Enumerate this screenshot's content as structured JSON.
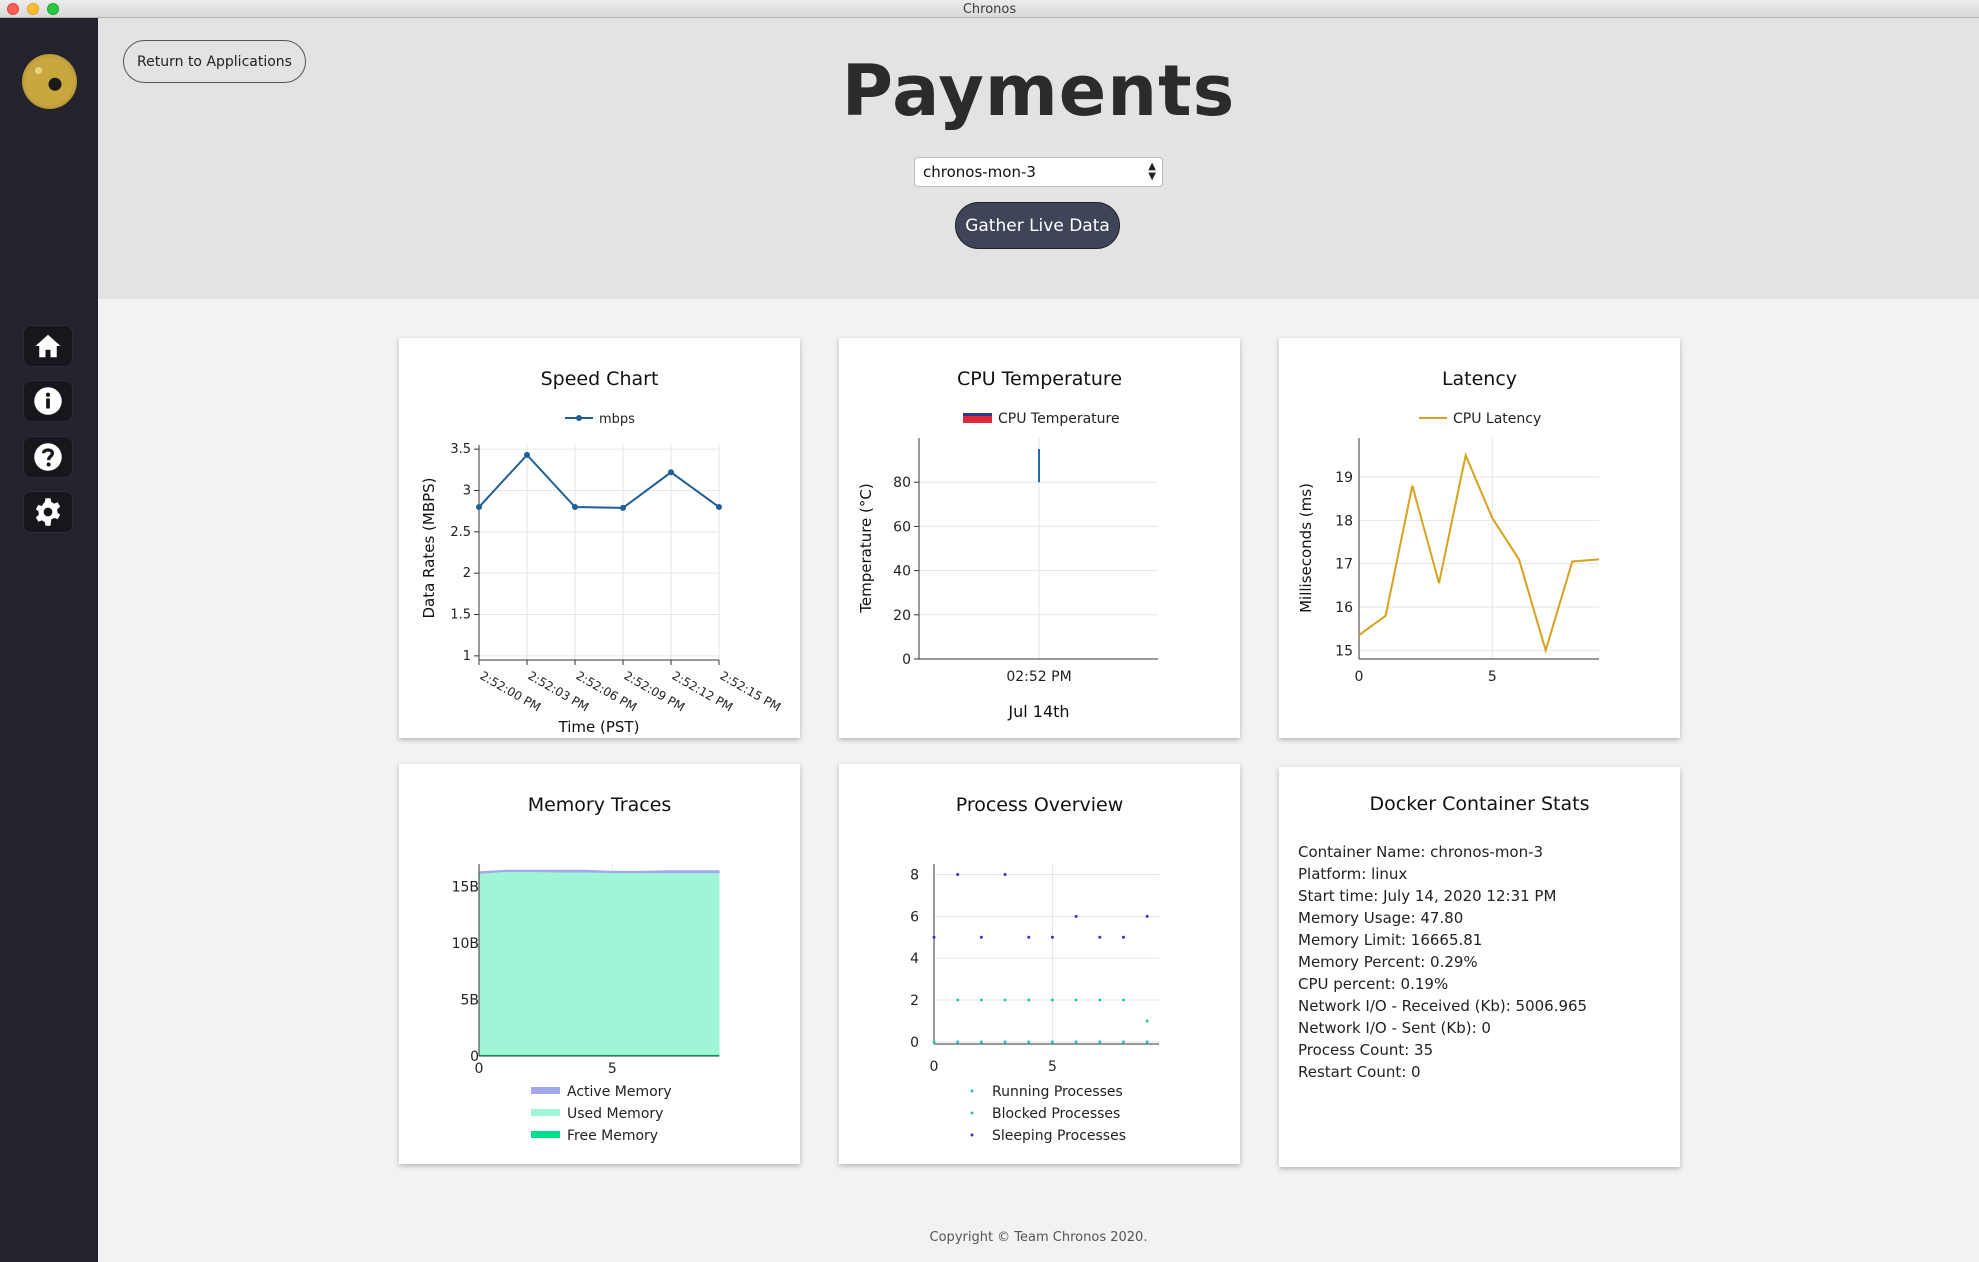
{
  "window": {
    "title": "Chronos"
  },
  "sidebar": {
    "logo": "chronos-logo",
    "items": [
      {
        "name": "home",
        "icon": "home-icon"
      },
      {
        "name": "info",
        "icon": "info-icon"
      },
      {
        "name": "help",
        "icon": "help-icon"
      },
      {
        "name": "settings",
        "icon": "gear-icon"
      }
    ]
  },
  "header": {
    "return_label": "Return to Applications",
    "title": "Payments",
    "selected_container": "chronos-mon-3",
    "gather_label": "Gather Live Data"
  },
  "cards": {
    "speed": {
      "title": "Speed Chart"
    },
    "cpu": {
      "title": "CPU Temperature"
    },
    "latency": {
      "title": "Latency"
    },
    "memory": {
      "title": "Memory Traces"
    },
    "process": {
      "title": "Process Overview"
    },
    "docker": {
      "title": "Docker Container Stats",
      "stats": [
        "Container Name: chronos-mon-3",
        "Platform: linux",
        "Start time: July 14, 2020 12:31 PM",
        "Memory Usage: 47.80",
        "Memory Limit: 16665.81",
        "Memory Percent: 0.29%",
        "CPU percent: 0.19%",
        "Network I/O - Received (Kb): 5006.965",
        "Network I/O - Sent (Kb): 0",
        "Process Count: 35",
        "Restart Count: 0"
      ]
    }
  },
  "footer": "Copyright © Team Chronos 2020.",
  "chart_data": [
    {
      "id": "speed",
      "type": "line",
      "title": "Speed Chart",
      "xlabel": "Time (PST)",
      "ylabel": "Data Rates (MBPS)",
      "categories": [
        "2:52:00 PM",
        "2:52:03 PM",
        "2:52:06 PM",
        "2:52:09 PM",
        "2:52:12 PM",
        "2:52:15 PM"
      ],
      "series": [
        {
          "name": "mbps",
          "values": [
            2.8,
            3.43,
            2.8,
            2.79,
            3.22,
            2.8
          ]
        }
      ],
      "yticks": [
        "1",
        "1.5",
        "2",
        "2.5",
        "3",
        "3.5"
      ],
      "ylim": [
        0.95,
        3.55
      ],
      "color": "#1f5f99",
      "legend": "top-center",
      "grid": true
    },
    {
      "id": "cpu",
      "type": "bar",
      "title": "CPU Temperature",
      "xlabel": "Jul 14th",
      "ylabel": "Temperature (°C)",
      "categories": [
        "02:52 PM"
      ],
      "series": [
        {
          "name": "CPU Temperature",
          "values": [
            95
          ]
        }
      ],
      "yticks": [
        "0",
        "20",
        "40",
        "60",
        "80"
      ],
      "ylim": [
        0,
        100
      ],
      "bar_range": [
        80,
        95
      ],
      "color": "#1f6bb0",
      "legend_color": "#e0283a",
      "legend": "top-center",
      "grid": true
    },
    {
      "id": "latency",
      "type": "line",
      "title": "Latency",
      "xlabel": "",
      "ylabel": "Milliseconds (ms)",
      "x": [
        0,
        1,
        2,
        3,
        4,
        5,
        6,
        7,
        8,
        9
      ],
      "series": [
        {
          "name": "CPU Latency",
          "values": [
            15.35,
            15.8,
            18.8,
            16.55,
            19.5,
            18.05,
            17.1,
            15.0,
            17.05,
            17.1
          ]
        }
      ],
      "xticks": [
        "0",
        "5"
      ],
      "yticks": [
        "15",
        "16",
        "17",
        "18",
        "19"
      ],
      "xlim": [
        0,
        9
      ],
      "ylim": [
        14.8,
        19.9
      ],
      "color": "#d9a11e",
      "legend": "top-center",
      "grid": true
    },
    {
      "id": "memory",
      "type": "area",
      "title": "Memory Traces",
      "xlabel": "",
      "ylabel": "",
      "x": [
        0,
        1,
        2,
        3,
        4,
        5,
        6,
        7,
        8,
        9
      ],
      "series": [
        {
          "name": "Active Memory",
          "values": [
            16.3,
            16.45,
            16.45,
            16.45,
            16.45,
            16.35,
            16.35,
            16.4,
            16.4,
            16.4
          ],
          "color": "#a3a8ee"
        },
        {
          "name": "Used Memory",
          "values": [
            16.1,
            16.25,
            16.25,
            16.2,
            16.2,
            16.15,
            16.15,
            16.15,
            16.15,
            16.15
          ],
          "color": "#9ff5d6"
        },
        {
          "name": "Free Memory",
          "values": [
            0.05,
            0.05,
            0.05,
            0.05,
            0.05,
            0.05,
            0.05,
            0.05,
            0.05,
            0.05
          ],
          "color": "#00e08a"
        }
      ],
      "xticks": [
        "0",
        "5"
      ],
      "yticks": [
        "0",
        "5B",
        "10B",
        "15B"
      ],
      "xlim": [
        0,
        9
      ],
      "ylim": [
        0,
        17
      ],
      "legend": "bottom",
      "grid": true
    },
    {
      "id": "process",
      "type": "scatter",
      "title": "Process Overview",
      "xlabel": "",
      "ylabel": "",
      "x": [
        0,
        1,
        2,
        3,
        4,
        5,
        6,
        7,
        8,
        9
      ],
      "series": [
        {
          "name": "Running Processes",
          "values": [
            0,
            0,
            0,
            0,
            0,
            0,
            0,
            0,
            0,
            0
          ],
          "color": "#28c5d8"
        },
        {
          "name": "Blocked Processes",
          "values": [
            0,
            2,
            2,
            2,
            2,
            2,
            2,
            2,
            2,
            1
          ],
          "color": "#2ec8a6"
        },
        {
          "name": "Sleeping Processes",
          "values": [
            5,
            8,
            5,
            8,
            5,
            5,
            6,
            5,
            5,
            6
          ],
          "color": "#3b2fd0"
        }
      ],
      "xticks": [
        "0",
        "5"
      ],
      "yticks": [
        "0",
        "2",
        "4",
        "6",
        "8"
      ],
      "xlim": [
        0,
        9.5
      ],
      "ylim": [
        -0.1,
        8.5
      ],
      "legend": "bottom",
      "grid": true
    }
  ]
}
